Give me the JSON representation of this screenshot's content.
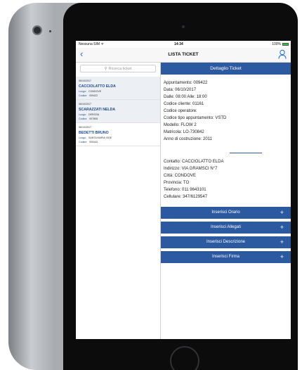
{
  "status_bar": {
    "carrier": "Nessuna SIM ᯤ",
    "time": "14:34",
    "battery": "100%"
  },
  "nav": {
    "back": "‹",
    "title": "LISTA TICKET",
    "user_icon": "user-icon"
  },
  "search": {
    "placeholder": "Ricerca ticket",
    "icon": "search-icon"
  },
  "tickets": [
    {
      "date": "06/10/2017",
      "name": "CACCIOLATTO ELDA",
      "luogo_label": "Luogo:",
      "luogo": "CONDOVE",
      "codice_label": "Codice:",
      "codice": "009422"
    },
    {
      "date": "06/10/2017",
      "name": "SCARAZZATI NELDA",
      "luogo_label": "Luogo:",
      "luogo": "DEROSA",
      "codice_label": "Codice:",
      "codice": "007808"
    },
    {
      "date": "06/10/2017",
      "name": "BEDETTI BRUNO",
      "luogo_label": "Luogo:",
      "luogo": "SANTA MARIA VIDE'",
      "codice_label": "Codice:",
      "codice": "009443"
    }
  ],
  "detail": {
    "header": "Dettaglio Ticket",
    "appuntamento": "Appuntamento: 009422",
    "data": "Data: 06/10/2017",
    "orario": "Dalle: 08:00     Alle: 18:00",
    "codice_cliente": "Codice cliente: 01161",
    "codice_operatore": "Codice operatore:",
    "codice_tipo": "Codice tipo appuntamento: VSTD",
    "modello": "Modello: FLOW 2",
    "matricola": "Matricola: LO-730842",
    "anno": "Anno di costruzione: 2011",
    "contatto": "Contatto: CACCIOLATTO ELDA",
    "indirizzo": "Indirizzo: VIA GRAMSCI N°7",
    "citta": "Città: CONDOVE",
    "provincia": "Provincia: TO",
    "telefono": "Telefono: 011 9643101",
    "cellulare": "Cellulare: 347/6129547"
  },
  "actions": [
    {
      "label": "Inserisci Orario",
      "plus": "+"
    },
    {
      "label": "Inserisci Allegati",
      "plus": "+"
    },
    {
      "label": "Inserisci Descrizione",
      "plus": "+"
    },
    {
      "label": "Inserisci Firma",
      "plus": "+"
    }
  ],
  "colors": {
    "accent": "#2c5aa0",
    "link": "#1a6fd1",
    "name": "#1e4b8f"
  }
}
